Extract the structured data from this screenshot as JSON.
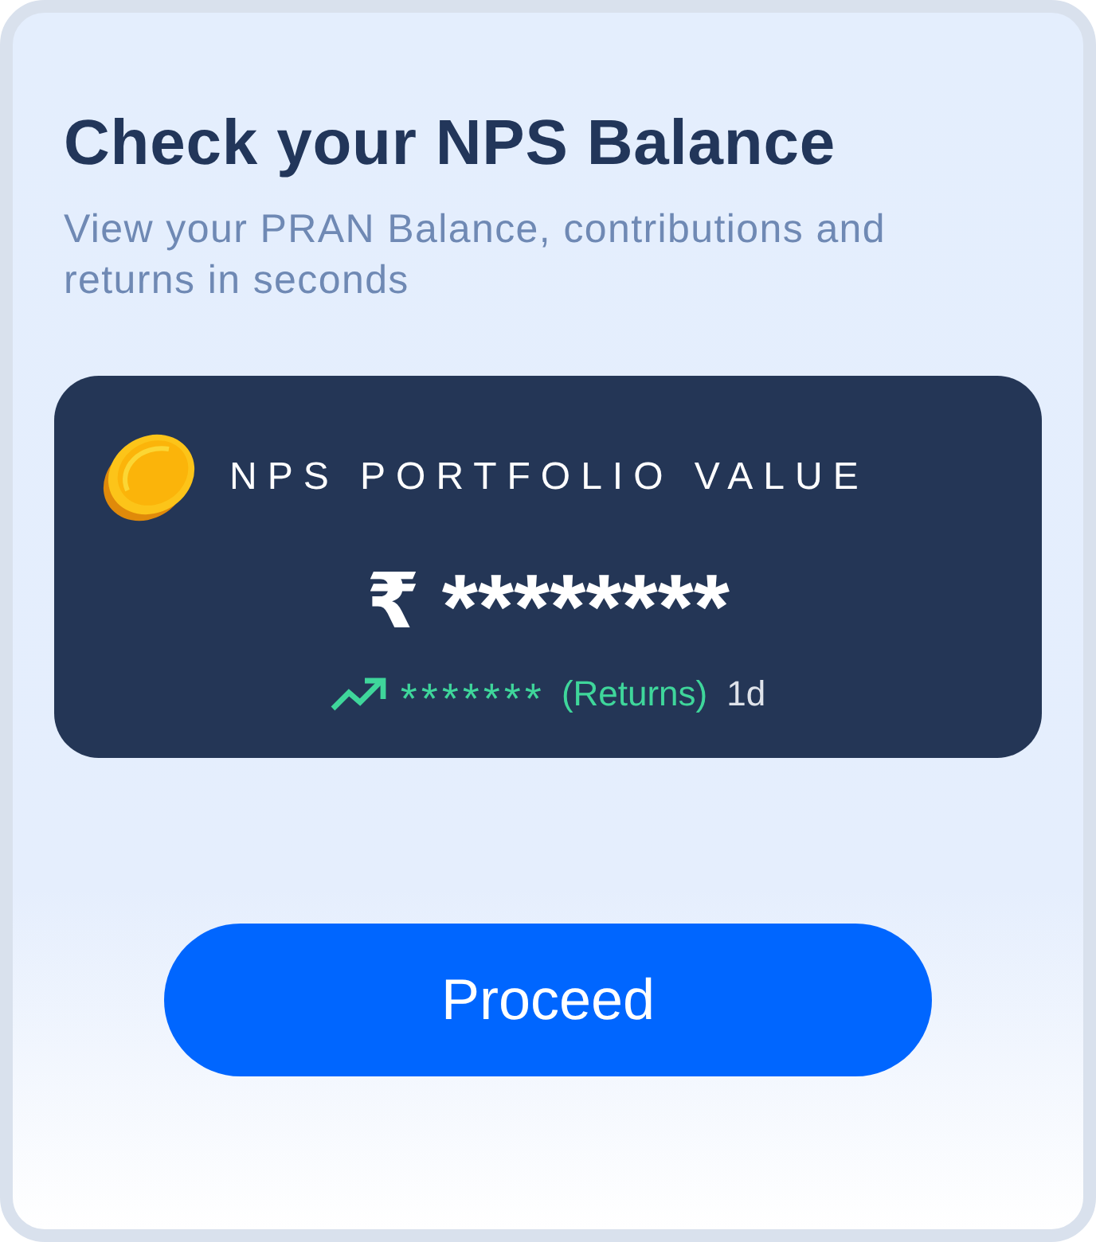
{
  "title": "Check your NPS Balance",
  "subtitle": "View your PRAN Balance, contributions and returns in seconds",
  "portfolio": {
    "label": "NPS PORTFOLIO VALUE",
    "currency": "₹",
    "value": "********",
    "returns": {
      "value": "*******",
      "label": "(Returns)",
      "period": "1d"
    }
  },
  "button": {
    "label": "Proceed"
  }
}
